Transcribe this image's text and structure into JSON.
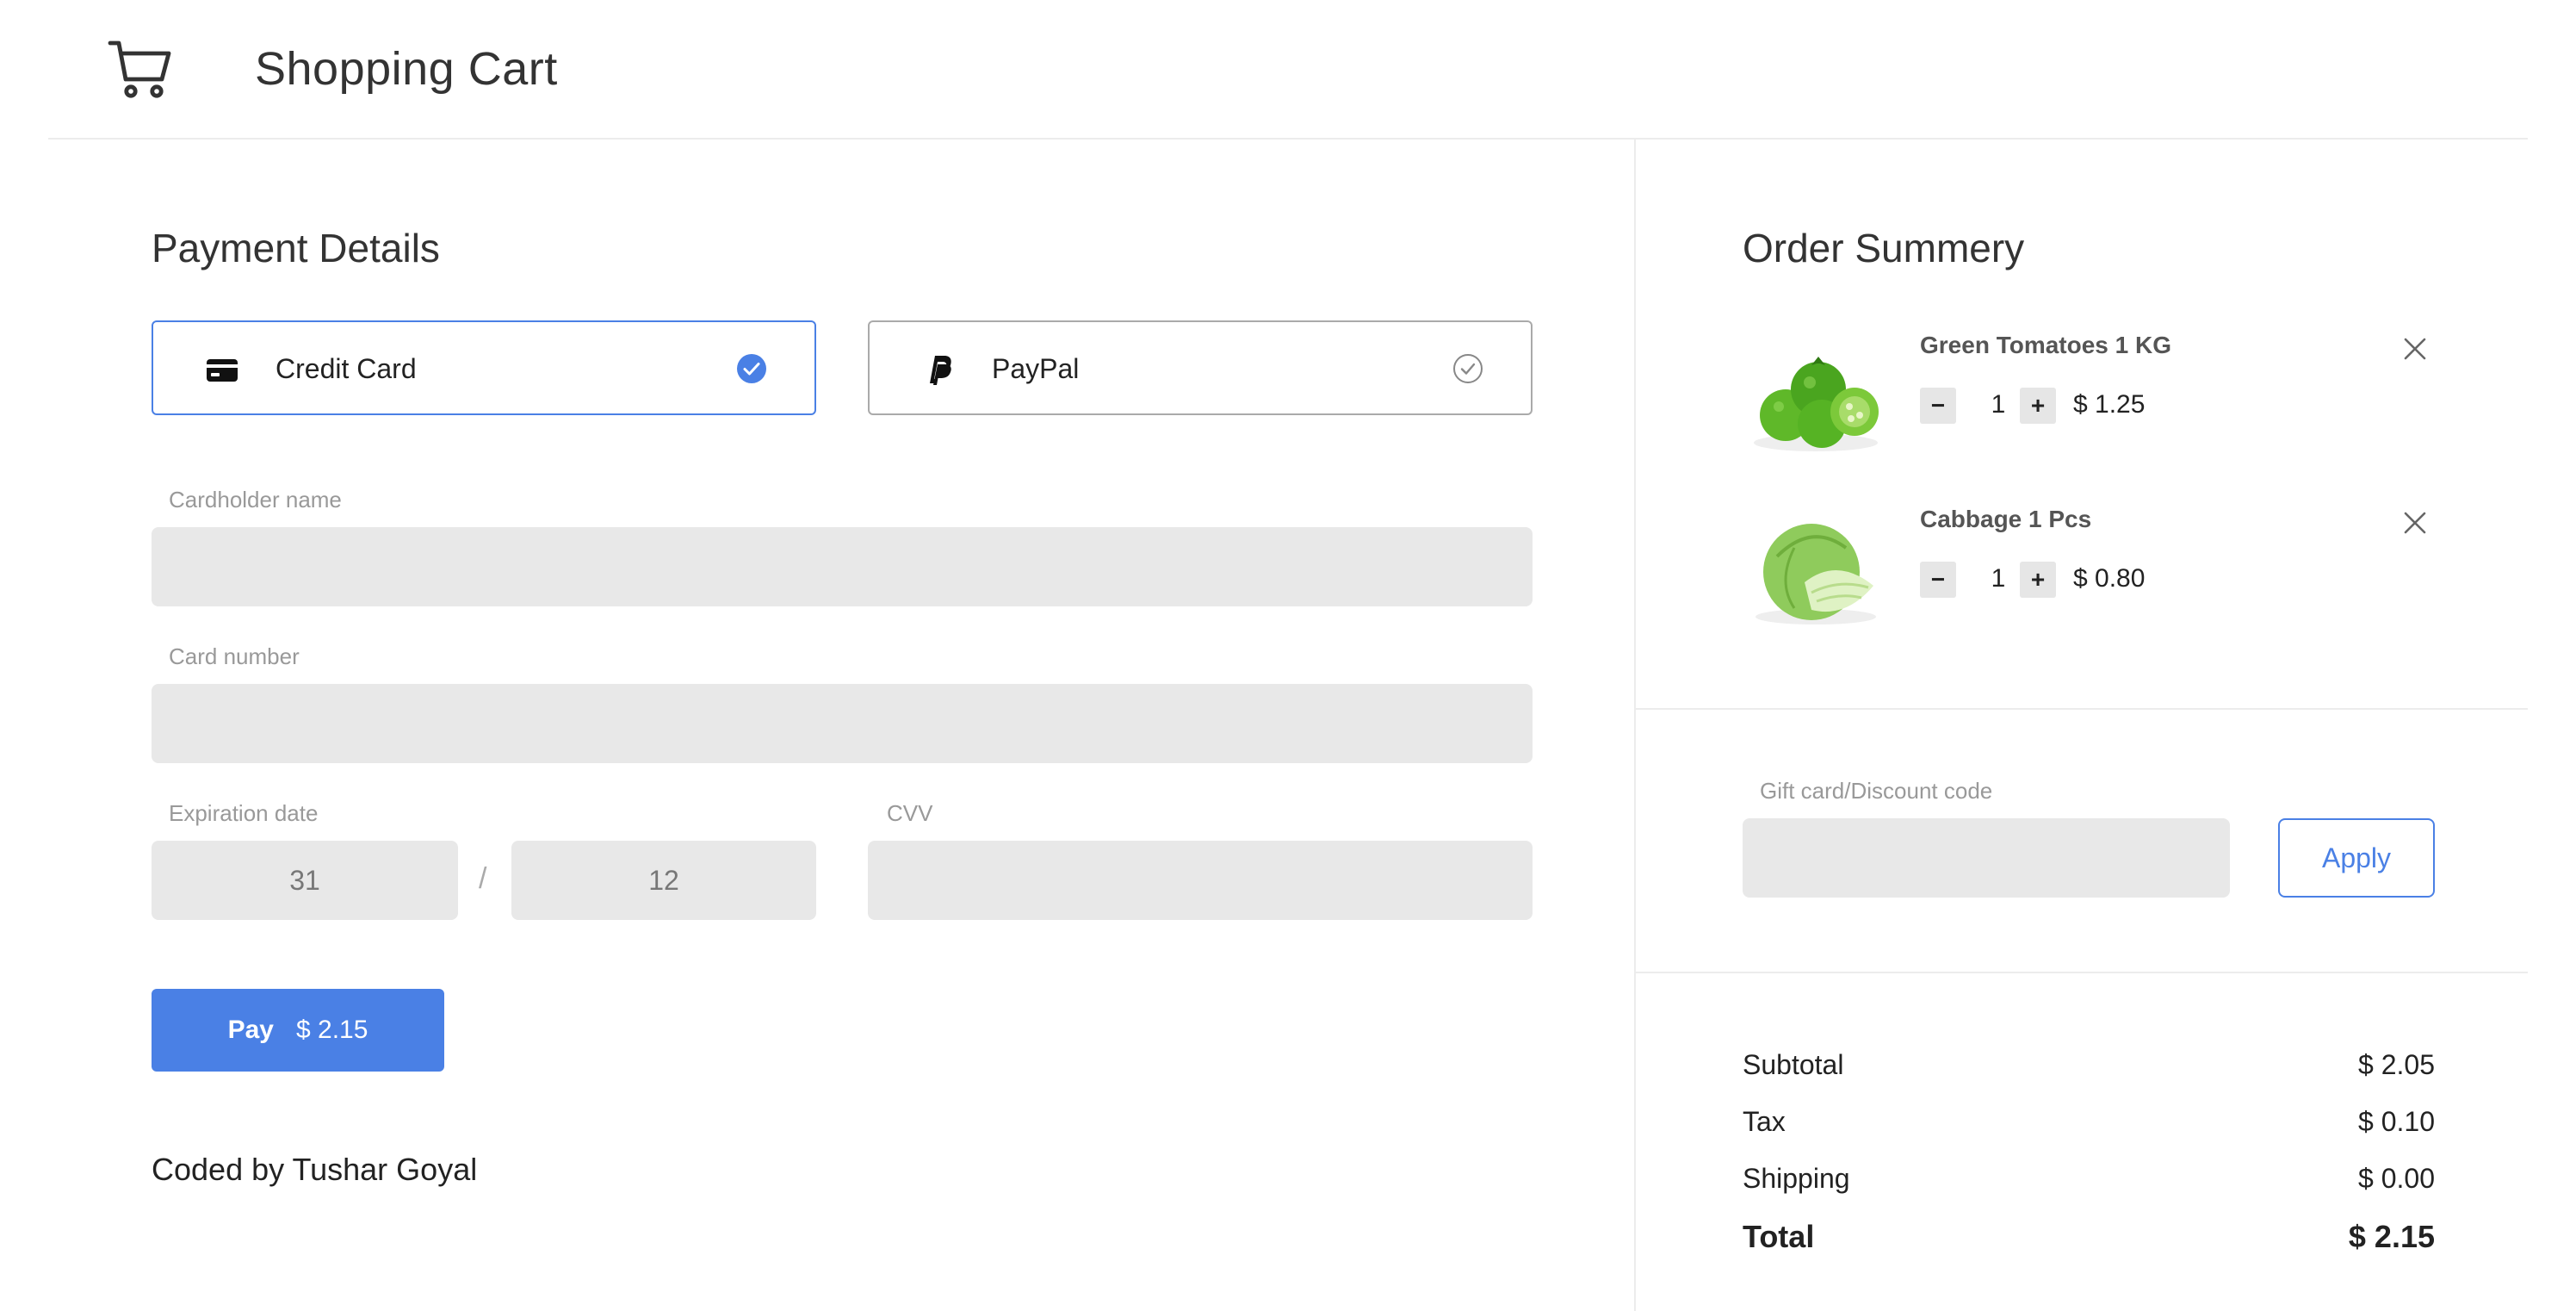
{
  "header": {
    "title": "Shopping Cart",
    "icon": "cart-icon"
  },
  "payment": {
    "title": "Payment Details",
    "methods": [
      {
        "label": "Credit Card",
        "icon": "credit-card-icon",
        "selected": true
      },
      {
        "label": "PayPal",
        "icon": "paypal-icon",
        "selected": false
      }
    ],
    "cardholder": {
      "label": "Cardholder name",
      "value": ""
    },
    "card_number": {
      "label": "Card number",
      "value": ""
    },
    "expiration": {
      "label": "Expiration date",
      "month": "31",
      "year": "12",
      "separator": "/"
    },
    "cvv": {
      "label": "CVV",
      "value": ""
    },
    "pay_button": {
      "label": "Pay",
      "amount": "$ 2.15"
    },
    "credit": "Coded by Tushar Goyal"
  },
  "summary": {
    "title": "Order Summery",
    "items": [
      {
        "name": "Green Tomatoes 1 KG",
        "qty": "1",
        "price": "$ 1.25",
        "minus": "−",
        "plus": "+"
      },
      {
        "name": "Cabbage 1 Pcs",
        "qty": "1",
        "price": "$ 0.80",
        "minus": "−",
        "plus": "+"
      }
    ],
    "discount": {
      "label": "Gift card/Discount code",
      "value": "",
      "apply_label": "Apply"
    },
    "totals": {
      "subtotal_label": "Subtotal",
      "subtotal": "$ 2.05",
      "tax_label": "Tax",
      "tax": "$ 0.10",
      "shipping_label": "Shipping",
      "shipping": "$ 0.00",
      "total_label": "Total",
      "total": "$ 2.15"
    }
  },
  "colors": {
    "accent": "#4a80e5",
    "field_bg": "#e8e8e8",
    "divider": "#ececec"
  }
}
